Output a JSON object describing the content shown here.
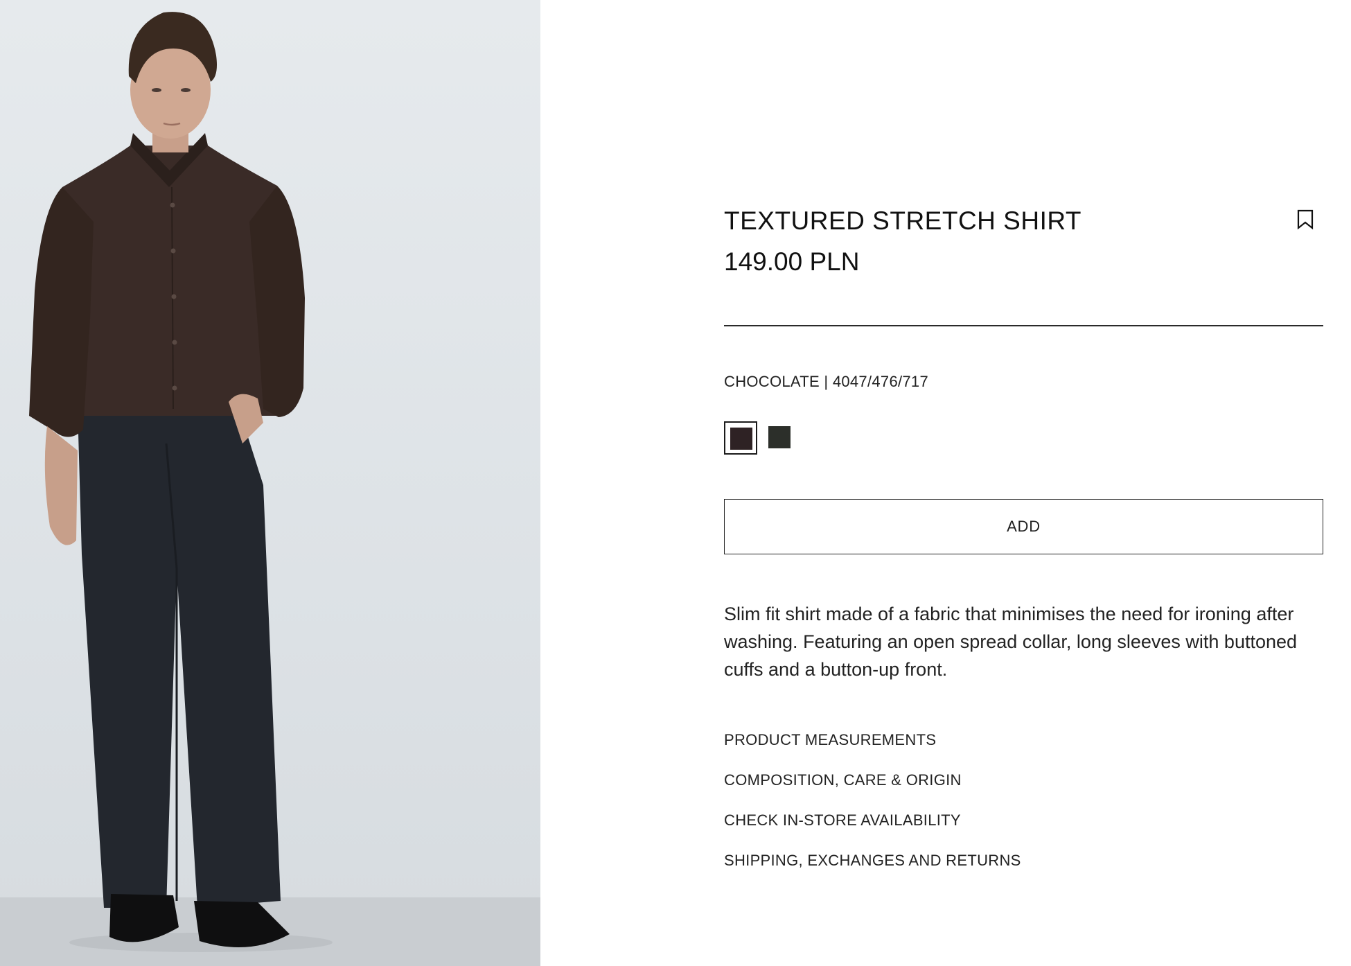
{
  "product": {
    "title": "TEXTURED STRETCH SHIRT",
    "price": "149.00 PLN",
    "color_line": "CHOCOLATE | 4047/476/717",
    "swatches": [
      {
        "name": "chocolate",
        "color": "#2e2224",
        "selected": true
      },
      {
        "name": "dark-green",
        "color": "#2c2f2a",
        "selected": false
      }
    ],
    "add_label": "ADD",
    "description": "Slim fit shirt made of a fabric that minimises the need for ironing after washing. Featuring an open spread collar, long sleeves with buttoned cuffs and a button-up front."
  },
  "links": [
    "PRODUCT MEASUREMENTS",
    "COMPOSITION, CARE & ORIGIN",
    "CHECK IN-STORE AVAILABILITY",
    "SHIPPING, EXCHANGES AND RETURNS"
  ],
  "icons": {
    "bookmark": "bookmark-icon"
  }
}
